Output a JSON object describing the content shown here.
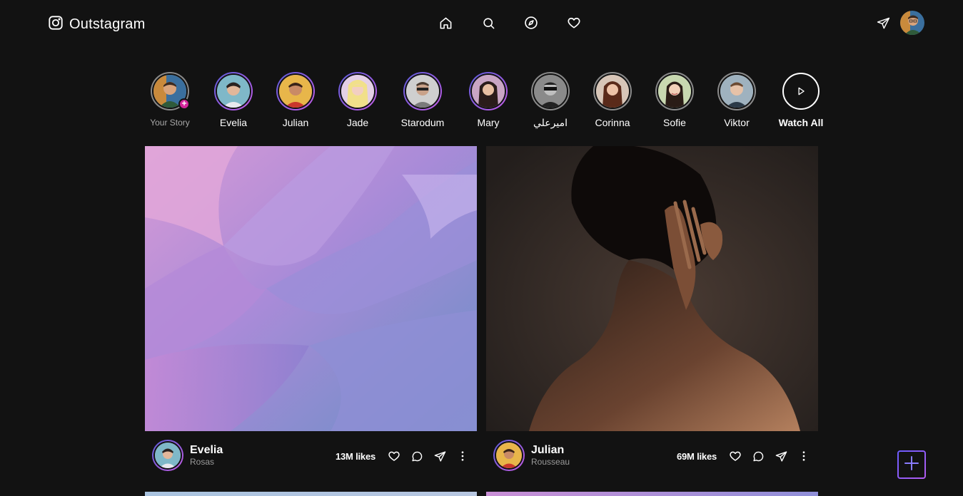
{
  "app": {
    "name": "Outstagram"
  },
  "header": {
    "nav": [
      {
        "icon": "home-icon"
      },
      {
        "icon": "search-icon"
      },
      {
        "icon": "compass-icon"
      },
      {
        "icon": "heart-icon"
      }
    ],
    "right": {
      "icon": "send-icon"
    }
  },
  "stories": {
    "items": [
      {
        "name": "Your Story"
      },
      {
        "name": "Evelia"
      },
      {
        "name": "Julian"
      },
      {
        "name": "Jade"
      },
      {
        "name": "Starodum"
      },
      {
        "name": "Mary"
      },
      {
        "name": "اميرعلي"
      },
      {
        "name": "Corinna"
      },
      {
        "name": "Sofie"
      },
      {
        "name": "Viktor"
      }
    ],
    "watch_all": "Watch All"
  },
  "posts": [
    {
      "name": "Evelia",
      "sub": "Rosas",
      "likes": "13M likes"
    },
    {
      "name": "Julian",
      "sub": "Rousseau",
      "likes": "69M likes"
    }
  ],
  "colors": {
    "background": "#121212",
    "accent": "#9b5de5",
    "badge": "#d3259b"
  }
}
